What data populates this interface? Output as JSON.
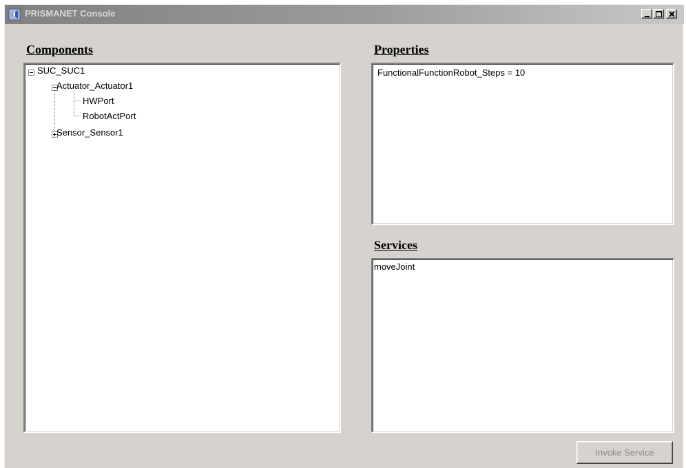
{
  "window": {
    "title": "PRISMANET Console",
    "controls": [
      "minimize",
      "maximize",
      "close"
    ]
  },
  "components": {
    "heading": "Components",
    "tree": [
      {
        "label": "SUC_SUC1",
        "expander": "minus"
      },
      {
        "label": "Actuator_Actuator1",
        "expander": "minus"
      },
      {
        "label": "HWPort",
        "expander": "none"
      },
      {
        "label": "RobotActPort",
        "expander": "none"
      },
      {
        "label": "Sensor_Sensor1",
        "expander": "plus"
      }
    ]
  },
  "properties": {
    "heading": "Properties",
    "items": [
      "FunctionalFunctionRobot_Steps = 10"
    ]
  },
  "services": {
    "heading": "Services",
    "items": [
      "moveJoint"
    ]
  },
  "invoke_button": {
    "label": "Invoke Service",
    "enabled": false
  }
}
